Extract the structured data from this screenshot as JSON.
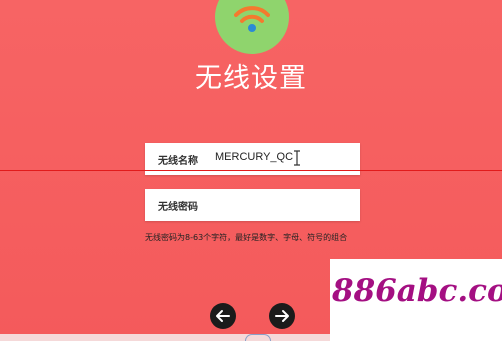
{
  "page": {
    "title": "无线设置",
    "background_color": "#f45f5f"
  },
  "logo": {
    "icon": "wifi-icon",
    "circle_color": "#8fd46d",
    "wave_color": "#f47a2e",
    "dot_color": "#2b8ad6"
  },
  "form": {
    "ssid_label": "无线名称",
    "ssid_value": "MERCURY_QC",
    "password_label": "无线密码",
    "password_value": "",
    "hint": "无线密码为8-63个字符，最好是数字、字母、符号的组合"
  },
  "navigation": {
    "prev_icon": "arrow-left-icon",
    "next_icon": "arrow-right-icon"
  },
  "watermark": {
    "text": "886abc.com",
    "color": "#a40f82"
  }
}
